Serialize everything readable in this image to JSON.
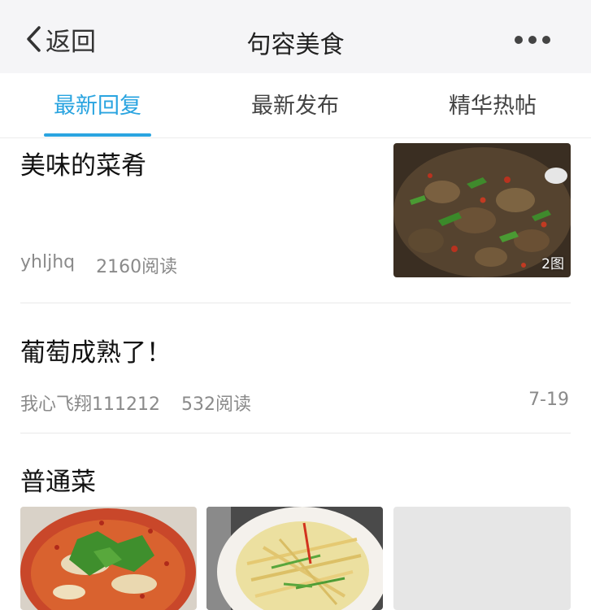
{
  "navbar": {
    "back_label": "返回",
    "title": "句容美食",
    "back_icon": "chevron-left-icon",
    "more_icon": "more-dots-icon"
  },
  "tabs": [
    {
      "label": "最新回复",
      "active": true
    },
    {
      "label": "最新发布",
      "active": false
    },
    {
      "label": "精华热帖",
      "active": false
    }
  ],
  "posts": [
    {
      "title": "美味的菜肴",
      "author": "yhljhq",
      "reads": "2160阅读",
      "image_count": "2图"
    },
    {
      "title": "葡萄成熟了！",
      "author": "我心飞翔111212",
      "reads": "532阅读",
      "date": "7-19"
    },
    {
      "title": "普通菜"
    }
  ],
  "colors": {
    "accent": "#2aa4e0",
    "meta_text": "#8a8a8a",
    "navbar_bg": "#f5f5f7"
  }
}
